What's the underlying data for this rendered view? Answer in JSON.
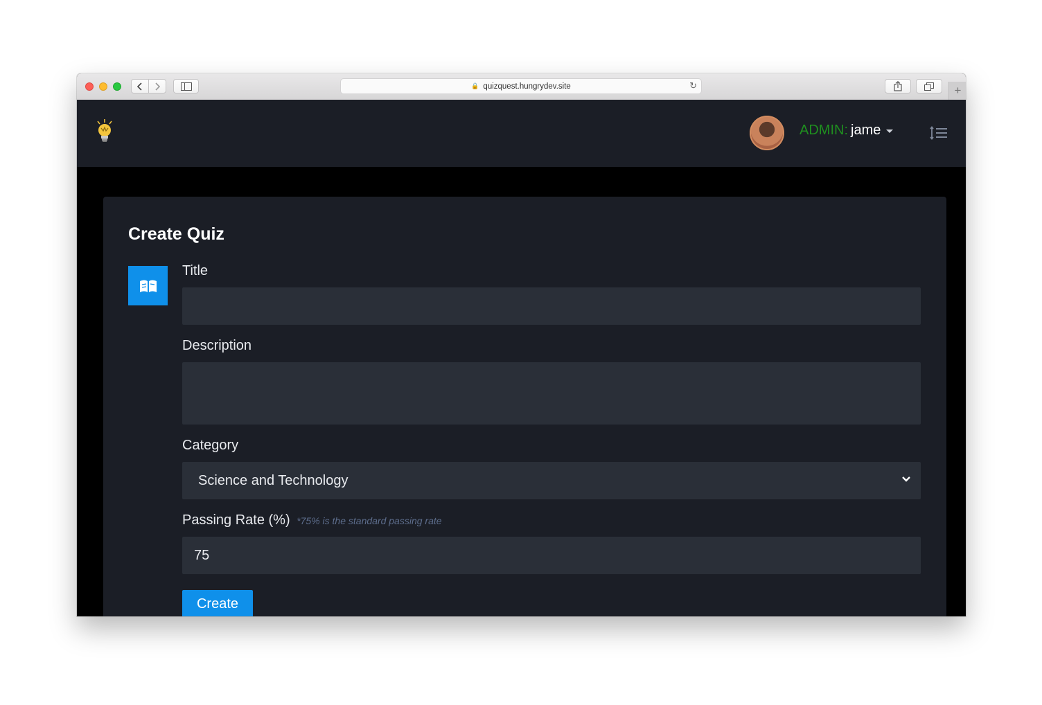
{
  "browser": {
    "url": "quizquest.hungrydev.site"
  },
  "navbar": {
    "user_role": "ADMIN:",
    "user_name": "jame"
  },
  "form": {
    "title": "Create Quiz",
    "fields": {
      "title": {
        "label": "Title",
        "value": ""
      },
      "description": {
        "label": "Description",
        "value": ""
      },
      "category": {
        "label": "Category",
        "selected": "Science and Technology"
      },
      "passing_rate": {
        "label": "Passing Rate (%)",
        "hint": "*75% is the standard passing rate",
        "value": "75"
      }
    },
    "submit_label": "Create"
  },
  "colors": {
    "accent": "#0f90ea",
    "role": "#1f8f1f",
    "panel": "#1b1e26",
    "input": "#2a2f38"
  }
}
